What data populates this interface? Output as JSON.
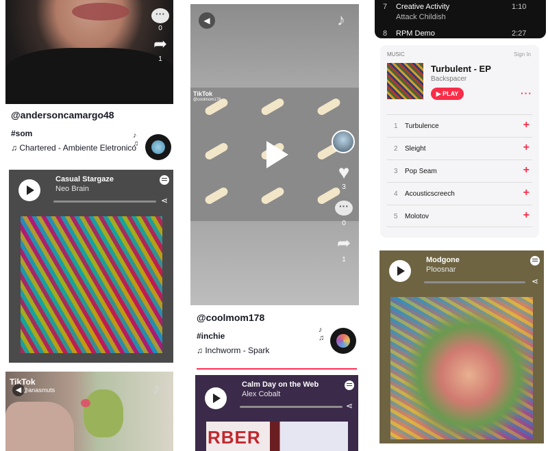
{
  "tiktok1": {
    "comments_count": "0",
    "shares_count": "1",
    "username": "@andersoncamargo48",
    "hashtag": "#som",
    "music": "Chartered - Ambiente Eletronico"
  },
  "spotify1": {
    "title": "Casual Stargaze",
    "artist": "Neo Brain"
  },
  "tiktok3": {
    "brand": "TikTok",
    "handle": "@anasmuts"
  },
  "tiktok2": {
    "brand": "TikTok",
    "handle": "@coolmom178",
    "likes_count": "3",
    "comments_count": "0",
    "shares_count": "1",
    "username": "@coolmom178",
    "hashtag": "#inchie",
    "music": "Inchworm - Spark"
  },
  "spotify2": {
    "title": "Calm Day on the Web",
    "artist": "Alex Cobalt"
  },
  "apple_prev": {
    "rows": [
      {
        "num": "7",
        "title": "Creative Activity",
        "artist": "Attack Childish",
        "time": "1:10"
      },
      {
        "num": "8",
        "title": "RPM Demo",
        "time": "2:27"
      }
    ]
  },
  "apple": {
    "brand": "MUSIC",
    "sign_in": "Sign In",
    "album": "Turbulent - EP",
    "artist": "Backspacer",
    "play": "PLAY",
    "tracks": [
      {
        "num": "1",
        "title": "Turbulence"
      },
      {
        "num": "2",
        "title": "Sleight"
      },
      {
        "num": "3",
        "title": "Pop Seam"
      },
      {
        "num": "4",
        "title": "Acousticscreech"
      },
      {
        "num": "5",
        "title": "Molotov"
      }
    ]
  },
  "spotify3": {
    "title": "Modgone",
    "artist": "Ploosnar"
  },
  "colors": {
    "apple_accent": "#fa2d48",
    "tiktok_divider": "#fe2c55"
  }
}
